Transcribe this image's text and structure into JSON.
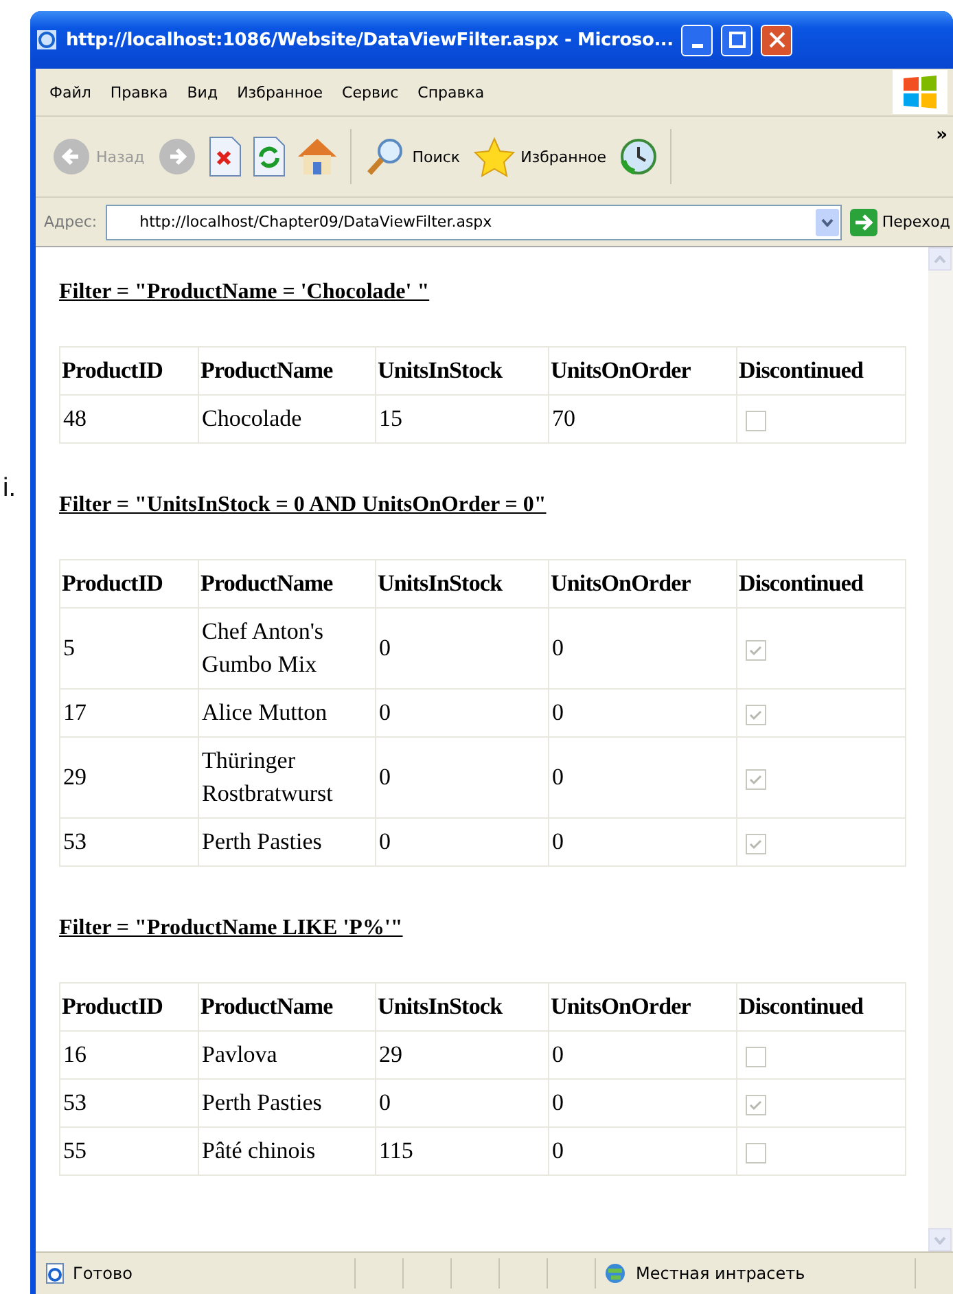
{
  "margin_text": "i.",
  "window": {
    "title": "http://localhost:1086/Website/DataViewFilter.aspx - Microso..."
  },
  "menu": [
    "Файл",
    "Правка",
    "Вид",
    "Избранное",
    "Сервис",
    "Справка"
  ],
  "toolbar": {
    "back": {
      "label": "Назад",
      "disabled": true
    },
    "forward": {
      "disabled": true
    },
    "search": "Поиск",
    "favorites": "Избранное",
    "overflow": "»"
  },
  "address": {
    "label": "Адрес:",
    "value": "http://localhost/Chapter09/DataViewFilter.aspx",
    "go": "Переход"
  },
  "sections": [
    {
      "heading": "Filter = \"ProductName = 'Chocolade' \"",
      "columns": [
        "ProductID",
        "ProductName",
        "UnitsInStock",
        "UnitsOnOrder",
        "Discontinued"
      ],
      "rows": [
        {
          "cells": [
            "48",
            "Chocolade",
            "15",
            "70"
          ],
          "checked": false
        }
      ]
    },
    {
      "heading": "Filter = \"UnitsInStock = 0 AND UnitsOnOrder = 0\"",
      "columns": [
        "ProductID",
        "ProductName",
        "UnitsInStock",
        "UnitsOnOrder",
        "Discontinued"
      ],
      "rows": [
        {
          "cells": [
            "5",
            "Chef Anton's Gumbo Mix",
            "0",
            "0"
          ],
          "checked": true
        },
        {
          "cells": [
            "17",
            "Alice Mutton",
            "0",
            "0"
          ],
          "checked": true
        },
        {
          "cells": [
            "29",
            "Thüringer Rostbratwurst",
            "0",
            "0"
          ],
          "checked": true
        },
        {
          "cells": [
            "53",
            "Perth Pasties",
            "0",
            "0"
          ],
          "checked": true
        }
      ]
    },
    {
      "heading": "Filter = \"ProductName LIKE 'P%'\"",
      "columns": [
        "ProductID",
        "ProductName",
        "UnitsInStock",
        "UnitsOnOrder",
        "Discontinued"
      ],
      "rows": [
        {
          "cells": [
            "16",
            "Pavlova",
            "29",
            "0"
          ],
          "checked": false
        },
        {
          "cells": [
            "53",
            "Perth Pasties",
            "0",
            "0"
          ],
          "checked": true
        },
        {
          "cells": [
            "55",
            "Pâté chinois",
            "115",
            "0"
          ],
          "checked": false
        }
      ]
    }
  ],
  "status_bar": {
    "text": "Готово",
    "zone": "Местная интрасеть"
  }
}
